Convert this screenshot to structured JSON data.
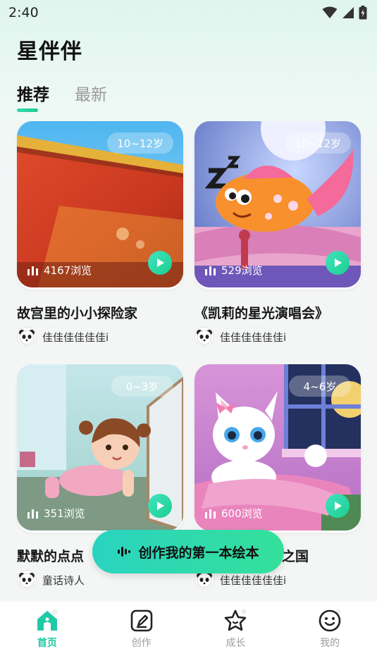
{
  "status_bar": {
    "time": "2:40"
  },
  "app": {
    "title": "星伴伴"
  },
  "tabs": [
    {
      "label": "推荐",
      "active": true
    },
    {
      "label": "最新",
      "active": false
    }
  ],
  "cards": [
    {
      "title": "故宫里的小小探险家",
      "age": "10~12岁",
      "views": "4167浏览",
      "author": "佳佳佳佳佳佳i",
      "theme": "palace-wall"
    },
    {
      "title": "《凯莉的星光演唱会》",
      "age": "10~12岁",
      "views": "529浏览",
      "author": "佳佳佳佳佳佳i",
      "theme": "sleeping-fish"
    },
    {
      "title": "默默的点点",
      "age": "0~3岁",
      "views": "351浏览",
      "author": "童话诗人",
      "theme": "crawling-baby"
    },
    {
      "title": "之国",
      "age": "4~6岁",
      "views": "600浏览",
      "author": "佳佳佳佳佳佳i",
      "theme": "white-kitten"
    }
  ],
  "fab": {
    "label": "创作我的第一本绘本",
    "icon": "sound-wave-icon"
  },
  "nav": [
    {
      "label": "首页",
      "icon": "home-icon",
      "active": true
    },
    {
      "label": "创作",
      "icon": "pen-icon",
      "active": false
    },
    {
      "label": "成长",
      "icon": "star-icon",
      "active": false
    },
    {
      "label": "我的",
      "icon": "smiley-icon",
      "active": false
    }
  ],
  "colors": {
    "accent": "#1ec9a3",
    "fab_start": "#2ad3c0",
    "fab_end": "#34e09a"
  }
}
